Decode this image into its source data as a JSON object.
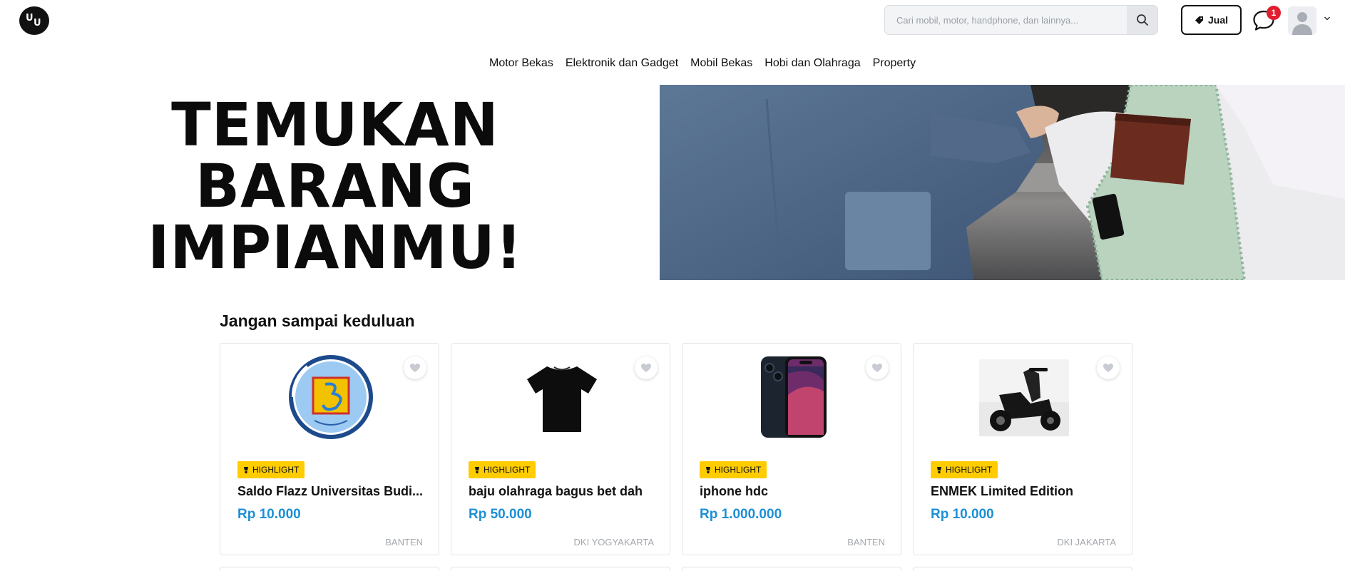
{
  "header": {
    "logo_text_1": "U",
    "logo_text_2": "U",
    "search_placeholder": "Cari mobil, motor, handphone, dan lainnya...",
    "sell_label": "Jual",
    "chat_badge_count": "1"
  },
  "nav": {
    "items": [
      "Motor Bekas",
      "Elektronik dan Gadget",
      "Mobil Bekas",
      "Hobi dan Olahraga",
      "Property"
    ]
  },
  "hero": {
    "line1": "TEMUKAN",
    "line2": "BARANG",
    "line3": "IMPIANMU!"
  },
  "section": {
    "title": "Jangan sampai keduluan"
  },
  "products": [
    {
      "badge": "HIGHLIGHT",
      "title": "Saldo Flazz Universitas Budi...",
      "price": "Rp 10.000",
      "location": "BANTEN",
      "icon": "university-logo"
    },
    {
      "badge": "HIGHLIGHT",
      "title": "baju olahraga bagus bet dah",
      "price": "Rp 50.000",
      "location": "DKI YOGYAKARTA",
      "icon": "tshirt"
    },
    {
      "badge": "HIGHLIGHT",
      "title": "iphone hdc",
      "price": "Rp 1.000.000",
      "location": "BANTEN",
      "icon": "iphone"
    },
    {
      "badge": "HIGHLIGHT",
      "title": "ENMEK Limited Edition",
      "price": "Rp 10.000",
      "location": "DKI JAKARTA",
      "icon": "scooter"
    }
  ],
  "colors": {
    "price": "#1d8fd6",
    "badge": "#ffcc00",
    "notification": "#e11d2e"
  }
}
